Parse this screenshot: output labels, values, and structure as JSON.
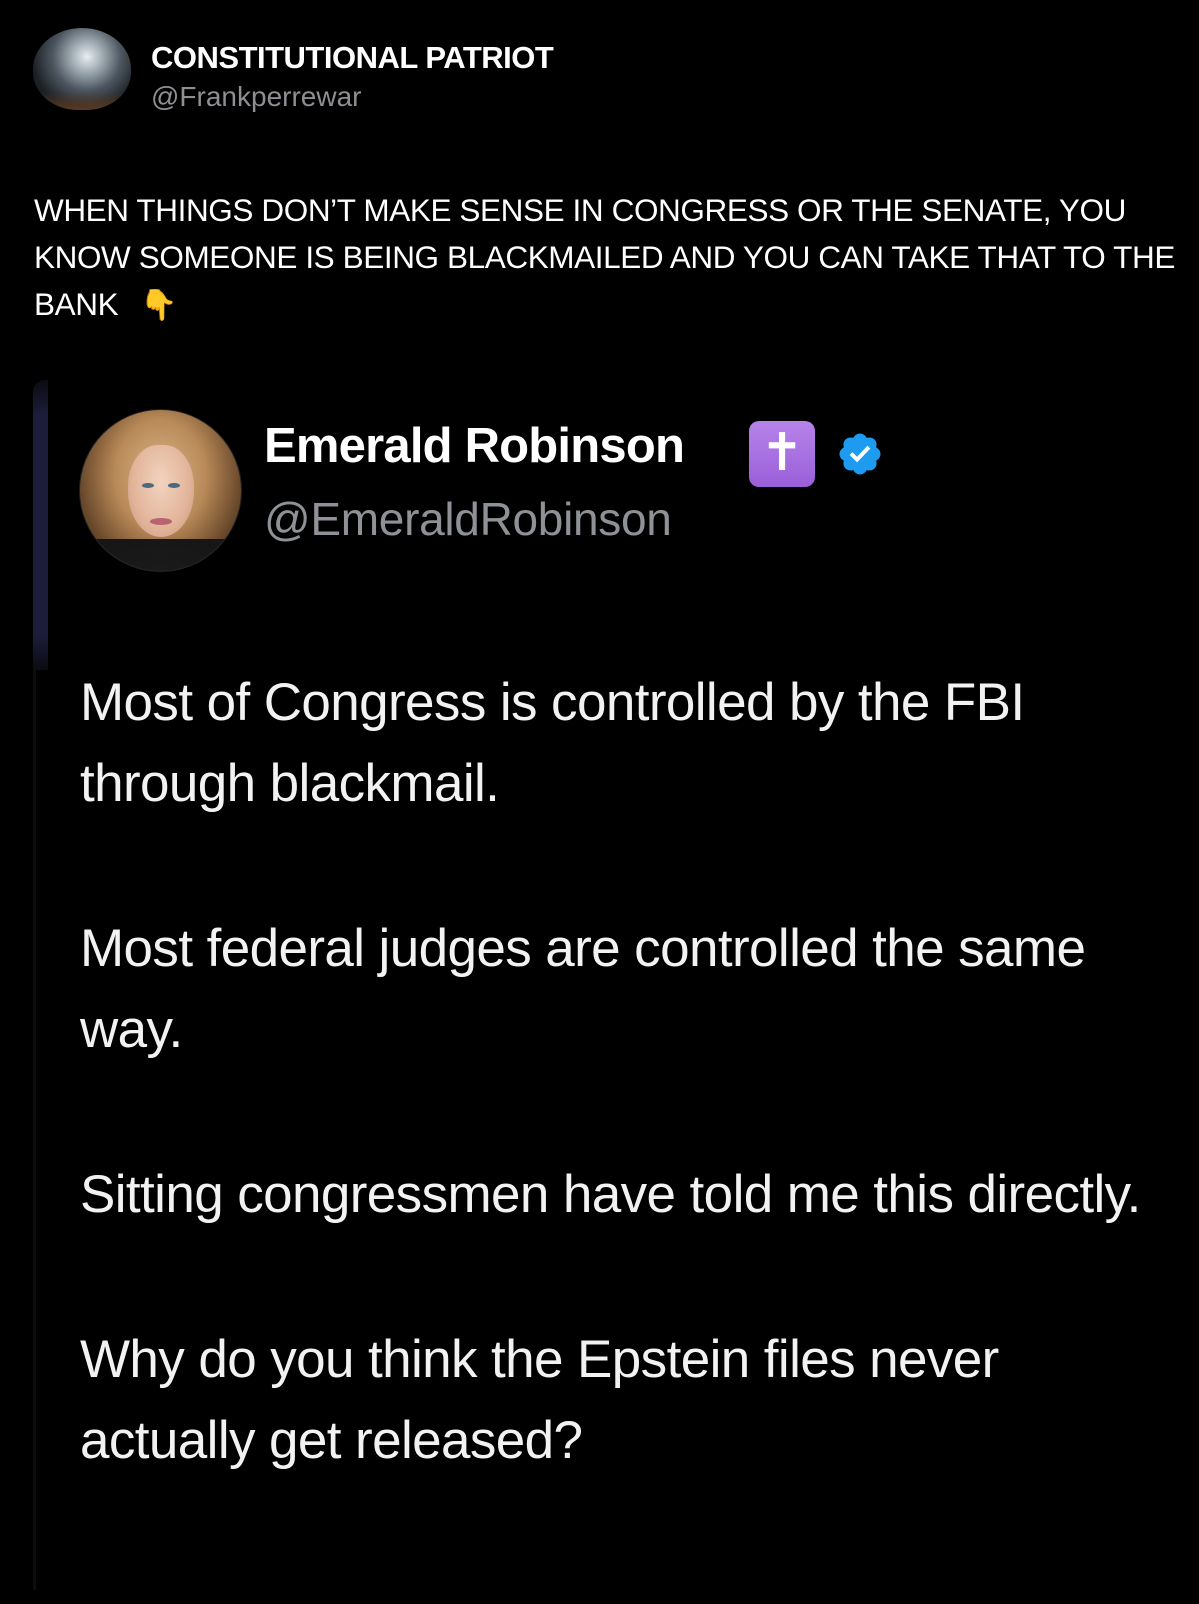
{
  "post": {
    "author_name": "CONSTITUTIONAL PATRIOT",
    "author_handle": "@Frankperrewar",
    "text": "WHEN THINGS DON’T MAKE SENSE IN CONGRESS OR THE SENATE, YOU KNOW SOMEONE IS BEING BLACKMAILED  AND YOU CAN TAKE THAT TO THE BANK",
    "emoji": "👇"
  },
  "quoted": {
    "author_name": "Emerald Robinson",
    "name_emoji": "✝",
    "verified_badge": "verified-icon",
    "author_handle": "@EmeraldRobinson",
    "paragraphs": [
      "Most of Congress is controlled by the FBI through blackmail.",
      "Most federal judges are controlled the same way.",
      "Sitting congressmen have told me this directly.",
      "Why do you think the Epstein files never actually get released?"
    ]
  },
  "colors": {
    "background": "#000000",
    "text": "#ffffff",
    "handle": "#8e8e93",
    "verified": "#1d9bf0",
    "cross_badge": "#a66ee0"
  }
}
